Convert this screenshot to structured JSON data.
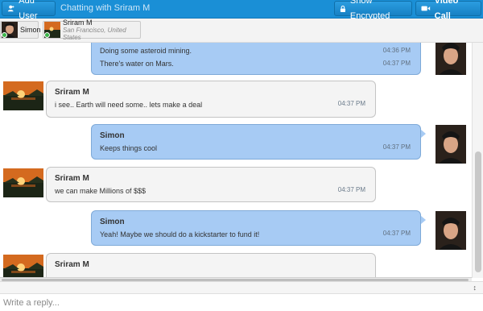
{
  "topbar": {
    "add_user_label": "Add User",
    "chat_title": "Chatting with Sriram M",
    "encrypted_label": "Show Encrypted",
    "video_label": "Video Call"
  },
  "tabs": [
    {
      "name": "Simon"
    },
    {
      "name": "Sriram M",
      "location": "San Francisco, United States"
    }
  ],
  "messages": [
    {
      "sender": "",
      "lines": [
        "Doing some asteroid mining.",
        "There's water on Mars."
      ],
      "times": [
        "04:36 PM",
        "04:37 PM"
      ],
      "direction": "out"
    },
    {
      "sender": "Sriram M",
      "lines": [
        "i see.. Earth will need some.. lets make a deal"
      ],
      "times": [
        "04:37 PM"
      ],
      "direction": "in"
    },
    {
      "sender": "Simon",
      "lines": [
        "Keeps things cool"
      ],
      "times": [
        "04:37 PM"
      ],
      "direction": "out"
    },
    {
      "sender": "Sriram M",
      "lines": [
        "we can make Millions of $$$"
      ],
      "times": [
        "04:37 PM"
      ],
      "direction": "in"
    },
    {
      "sender": "Simon",
      "lines": [
        "Yeah! Maybe we should do a kickstarter to fund it!"
      ],
      "times": [
        "04:37 PM"
      ],
      "direction": "out"
    },
    {
      "sender": "Sriram M",
      "lines": [],
      "times": [],
      "direction": "in"
    }
  ],
  "reply": {
    "placeholder": "Write a reply..."
  },
  "colors": {
    "topbar": "#1a8fd6",
    "outgoing_bubble": "#a7cbf4",
    "incoming_bubble": "#f4f4f4"
  }
}
